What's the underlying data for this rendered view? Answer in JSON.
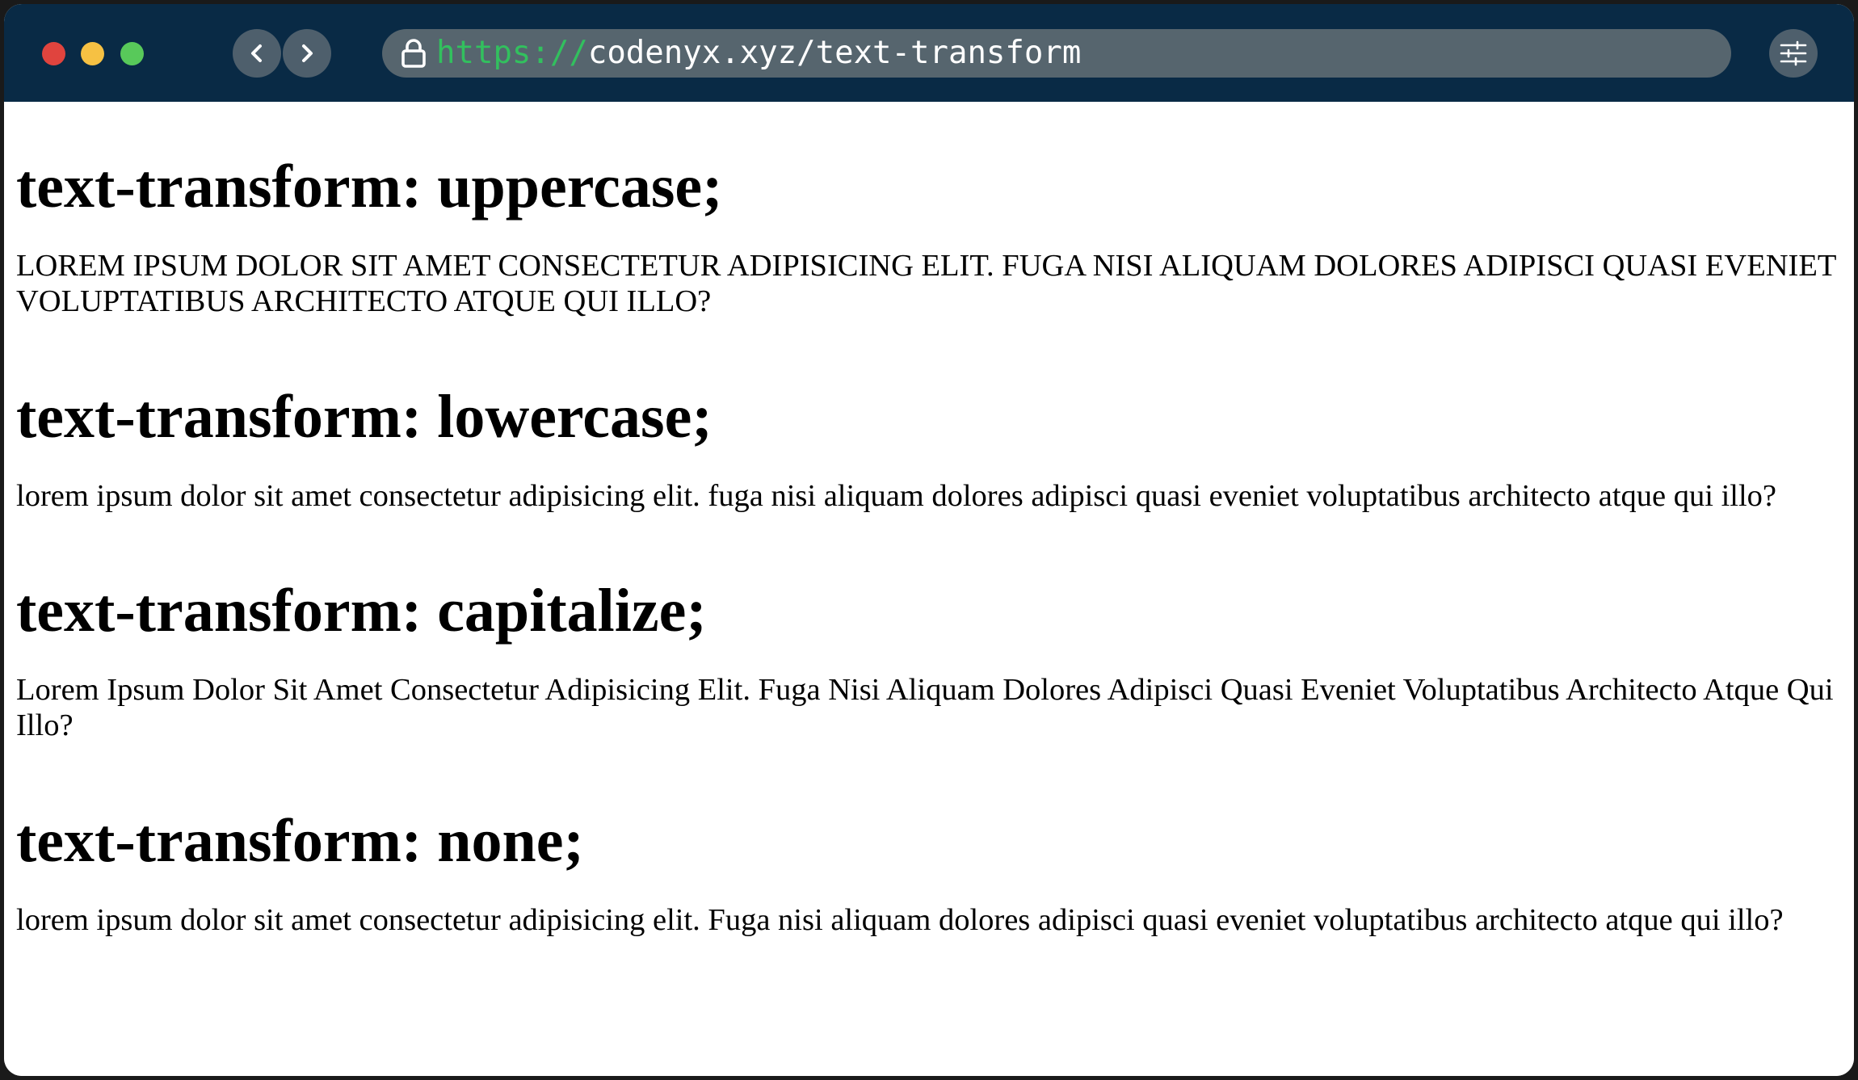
{
  "browser": {
    "url_protocol": "https://",
    "url_rest": "codenyx.xyz/text-transform"
  },
  "sections": [
    {
      "heading": "text-transform: uppercase;",
      "text": "Lorem ipsum dolor sit amet consectetur adipisicing elit. Fuga nisi aliquam dolores adipisci quasi eveniet voluptatibus architecto atque qui illo?"
    },
    {
      "heading": "text-transform: lowercase;",
      "text": "Lorem ipsum dolor sit amet consectetur adipisicing elit. Fuga nisi aliquam dolores adipisci quasi eveniet voluptatibus architecto atque qui illo?"
    },
    {
      "heading": "text-transform: capitalize;",
      "text": "lorem ipsum dolor sit amet consectetur adipisicing elit. Fuga nisi aliquam dolores adipisci quasi eveniet voluptatibus architecto atque qui illo?"
    },
    {
      "heading": "text-transform: none;",
      "text": "lorem ipsum dolor sit amet consectetur adipisicing elit. Fuga nisi aliquam dolores adipisci quasi eveniet voluptatibus architecto atque qui illo?"
    }
  ],
  "icons": {
    "back": "chevron-left-icon",
    "forward": "chevron-right-icon",
    "lock": "lock-icon",
    "menu": "sliders-icon"
  },
  "colors": {
    "toolbar": "#092a45",
    "urlbar": "#56656e",
    "protocol": "#32c05e",
    "close": "#e0443e",
    "minimize": "#f6c143",
    "maximize": "#58c95a"
  }
}
